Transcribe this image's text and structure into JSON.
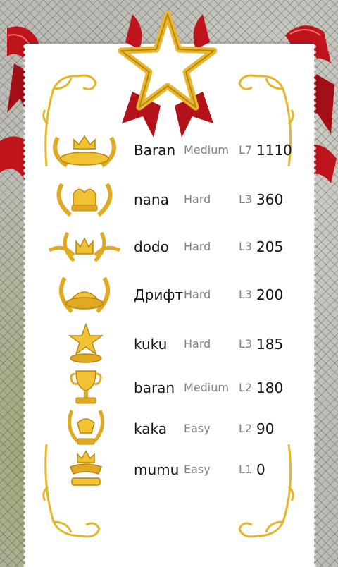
{
  "colors": {
    "paper": "#ffffff",
    "ribbon_red": "#c0141c",
    "gold": "#f1c232",
    "gold_dark": "#b98611",
    "text_primary": "#151515",
    "text_secondary": "#808080"
  },
  "icons": {
    "header": "star-badge-icon",
    "ranks": [
      "laurel-crown-icon",
      "royal-crown-laurel-icon",
      "winged-crown-icon",
      "tiara-laurel-icon",
      "star-trophy-icon",
      "cup-trophy-icon",
      "laurel-cup-icon",
      "crown-ribbon-icon"
    ]
  },
  "scores": [
    {
      "name": "Baran",
      "difficulty": "Medium",
      "level": "L7",
      "score": "1110"
    },
    {
      "name": "nana",
      "difficulty": "Hard",
      "level": "L3",
      "score": "360"
    },
    {
      "name": "dodo",
      "difficulty": "Hard",
      "level": "L3",
      "score": "205"
    },
    {
      "name": "Дрифт",
      "difficulty": "Hard",
      "level": "L3",
      "score": "200"
    },
    {
      "name": "kuku",
      "difficulty": "Hard",
      "level": "L3",
      "score": "185"
    },
    {
      "name": "baran",
      "difficulty": "Medium",
      "level": "L2",
      "score": "180"
    },
    {
      "name": "kaka",
      "difficulty": "Easy",
      "level": "L2",
      "score": "90"
    },
    {
      "name": "mumu",
      "difficulty": "Easy",
      "level": "L1",
      "score": "0"
    }
  ]
}
